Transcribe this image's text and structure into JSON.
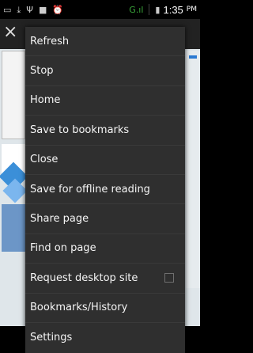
{
  "status_bar": {
    "time": "1:35",
    "ampm": "PM",
    "icons": [
      "notification-icon",
      "download-icon",
      "usb-icon",
      "media-icon",
      "alarm-icon",
      "signal-icon",
      "battery-icon"
    ],
    "signal_text": "G",
    "accent": "#3aa53a"
  },
  "browser": {
    "close_glyph": "×"
  },
  "menu": {
    "items": [
      {
        "label": "Refresh"
      },
      {
        "label": "Stop"
      },
      {
        "label": "Home"
      },
      {
        "label": "Save to bookmarks"
      },
      {
        "label": "Close"
      },
      {
        "label": "Save for offline reading"
      },
      {
        "label": "Share page"
      },
      {
        "label": "Find on page"
      },
      {
        "label": "Request desktop site",
        "checkbox": false
      },
      {
        "label": "Bookmarks/History"
      },
      {
        "label": "Settings"
      }
    ]
  },
  "colors": {
    "menu_background": "#2f2f2f",
    "divider": "#3a3a3a",
    "page_background": "#dfe6ea"
  }
}
